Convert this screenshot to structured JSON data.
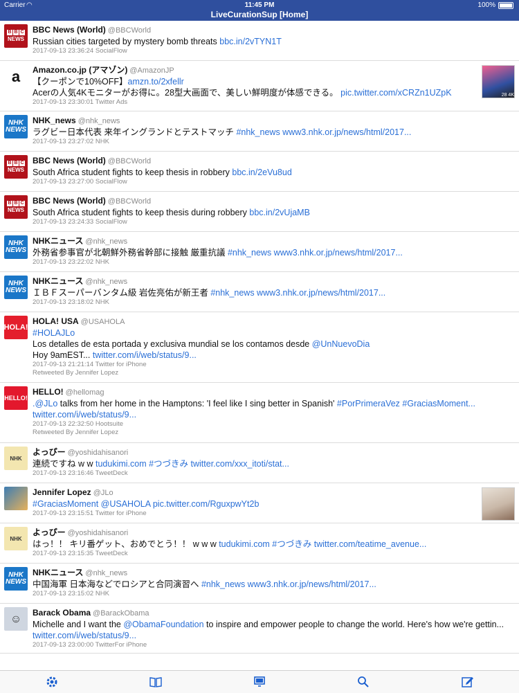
{
  "status": {
    "carrier": "Carrier",
    "time": "11:45 PM",
    "battery": "100%"
  },
  "header": {
    "title": "LiveCurationSup [Home]"
  },
  "tweets": [
    {
      "avatar": "bbc-news-logo",
      "name": "BBC News (World)",
      "handle": "@BBCWorld",
      "text": "Russian cities targeted by mystery bomb threats ",
      "link": "bbc.in/2vTYN1T",
      "meta": "2017-09-13 23:36:24 SocialFlow"
    },
    {
      "avatar": "amazon-logo",
      "name": "Amazon.co.jp (アマゾン)",
      "handle": "@AmazonJP",
      "text": "【クーポンで10%OFF】",
      "link": "amzn.to/2xfellr",
      "text2": "Acerの人気4Kモニターがお得に。28型大画面で、美しい鮮明度が体感できる。 ",
      "link2": "pic.twitter.com/xCRZn1UZpK",
      "meta": "2017-09-13 23:30:01 Twitter Ads",
      "thumb": "monitor-image"
    },
    {
      "avatar": "nhk-news-logo",
      "name": "NHK_news",
      "handle": "@nhk_news",
      "text": "ラグビー日本代表 来年イングランドとテストマッチ ",
      "link": "#nhk_news www3.nhk.or.jp/news/html/2017...",
      "meta": "2017-09-13 23:27:02 NHK"
    },
    {
      "avatar": "bbc-news-logo",
      "name": "BBC News (World)",
      "handle": "@BBCWorld",
      "text": "South Africa student fights to keep thesis in robbery ",
      "link": "bbc.in/2eVu8ud",
      "meta": "2017-09-13 23:27:00 SocialFlow"
    },
    {
      "avatar": "bbc-news-logo",
      "name": "BBC News (World)",
      "handle": "@BBCWorld",
      "text": "South Africa student fights to keep thesis during robbery ",
      "link": "bbc.in/2vUjaMB",
      "meta": "2017-09-13 23:24:33 SocialFlow"
    },
    {
      "avatar": "nhk-news-logo",
      "name": "NHKニュース",
      "handle": "@nhk_news",
      "text": "外務省参事官が北朝鮮外務省幹部に接触 厳重抗議 ",
      "link": "#nhk_news www3.nhk.or.jp/news/html/2017...",
      "meta": "2017-09-13 23:22:02 NHK"
    },
    {
      "avatar": "nhk-news-logo",
      "name": "NHKニュース",
      "handle": "@nhk_news",
      "text": "ＩＢＦスーパーバンタム級 岩佐亮佑が新王者 ",
      "link": "#nhk_news www3.nhk.or.jp/news/html/2017...",
      "meta": "2017-09-13 23:18:02 NHK"
    },
    {
      "avatar": "hola-logo",
      "name": "HOLA! USA",
      "handle": "@USAHOLA",
      "link0": "#HOLAJLo",
      "text": "Los detalles de esta portada y exclusiva mundial se los contamos desde ",
      "link": "@UnNuevoDia",
      "text2": "Hoy 9amEST... ",
      "link2": "twitter.com/i/web/status/9...",
      "meta": "2017-09-13 21:21:14 Twitter for iPhone",
      "retweet": "Retweeted By Jennifer Lopez"
    },
    {
      "avatar": "hello-logo",
      "name": "HELLO!",
      "handle": "@hellomag",
      "link0": ".@JLo",
      "text": " talks from her home in the Hamptons: 'I feel like I sing better in Spanish' ",
      "link": "#PorPrimeraVez #GraciasMoment...",
      "link2": "twitter.com/i/web/status/9...",
      "meta": "2017-09-13 22:32:50 Hootsuite",
      "retweet": "Retweeted By Jennifer Lopez"
    },
    {
      "avatar": "yoshida-avatar",
      "name": "よっぴー",
      "handle": "@yoshidahisanori",
      "text": "連続ですね w w ",
      "link": "tudukimi.com #つづきみ twitter.com/xxx_itoti/stat...",
      "meta": "2017-09-13 23:16:46 TweetDeck"
    },
    {
      "avatar": "jlo-avatar",
      "name": "Jennifer Lopez",
      "handle": "@JLo",
      "text": "",
      "link": "#GraciasMoment @USAHOLA pic.twitter.com/RguxpwYt2b",
      "meta": "2017-09-13 23:15:51 Twitter for iPhone",
      "thumb": "magazine-cover"
    },
    {
      "avatar": "yoshida-avatar",
      "name": "よっぴー",
      "handle": "@yoshidahisanori",
      "text": "はっ！！ キリ番ゲット、おめでとう！！ w w w ",
      "link": "tudukimi.com  #つづきみ twitter.com/teatime_avenue...",
      "meta": "2017-09-13 23:15:35 TweetDeck"
    },
    {
      "avatar": "nhk-news-logo",
      "name": "NHKニュース",
      "handle": "@nhk_news",
      "text": "中国海軍 日本海などでロシアと合同演習へ ",
      "link": "#nhk_news www3.nhk.or.jp/news/html/2017...",
      "meta": "2017-09-13 23:15:02 NHK"
    },
    {
      "avatar": "obama-avatar",
      "name": "Barack Obama",
      "handle": "@BarackObama",
      "text": "Michelle and I want the ",
      "link": "@ObamaFoundation",
      "text_after": " to inspire and empower people to change the world. Here's how we're gettin...",
      "link2": "twitter.com/i/web/status/9...",
      "meta": "2017-09-13 23:00:00 TwitterFor iPhone"
    }
  ],
  "tabbar": {
    "icons": [
      "gear-icon",
      "book-icon",
      "display-icon",
      "search-icon",
      "compose-icon"
    ]
  },
  "colors": {
    "bar": "#2f4f9e",
    "link": "#2a6fd6",
    "tabActive": "#1a5fcf"
  }
}
